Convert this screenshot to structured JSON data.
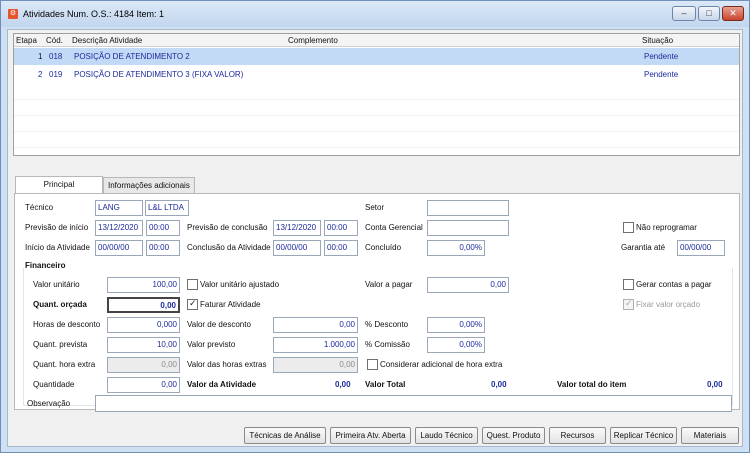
{
  "window": {
    "title": "Atividades Num. O.S.: 4184  Item: 1",
    "minimize": "–",
    "maximize": "□",
    "close": "✕"
  },
  "grid": {
    "columns": [
      "Etapa",
      "Cód.",
      "Descrição Atividade",
      "Complemento",
      "Situação"
    ],
    "rows": [
      {
        "etapa": "1",
        "cod": "018",
        "descricao": "POSIÇÃO DE ATENDIMENTO 2",
        "complemento": "",
        "situacao": "Pendente",
        "selected": true
      },
      {
        "etapa": "2",
        "cod": "019",
        "descricao": "POSIÇÃO DE ATENDIMENTO 3 (FIXA VALOR)",
        "complemento": "",
        "situacao": "Pendente",
        "selected": false
      }
    ]
  },
  "tabs": [
    {
      "label": "Principal",
      "active": true
    },
    {
      "label": "Informações adicionais",
      "active": false
    }
  ],
  "form": {
    "tecnico_label": "Técnico",
    "tecnico_code": "LANG",
    "tecnico_name": "L&L LTDA",
    "setor_label": "Setor",
    "setor_value": "",
    "prev_inicio_label": "Previsão de início",
    "prev_inicio_date": "13/12/2020",
    "prev_inicio_time": "00:00",
    "prev_conclusao_label": "Previsão de conclusão",
    "prev_conclusao_date": "13/12/2020",
    "prev_conclusao_time": "00:00",
    "conta_gerencial_label": "Conta Gerencial",
    "conta_gerencial_value": "",
    "nao_reprogramar_label": "Não reprogramar",
    "inicio_atividade_label": "Início da Atividade",
    "inicio_atividade_date": "00/00/00",
    "inicio_atividade_time": "00:00",
    "conclusao_atividade_label": "Conclusão da Atividade",
    "conclusao_atividade_date": "00/00/00",
    "conclusao_atividade_time": "00:00",
    "concluido_label": "Concluído",
    "concluido_value": "0,00%",
    "garantia_label": "Garantia até",
    "garantia_value": "00/00/00"
  },
  "financeiro": {
    "title": "Financeiro",
    "valor_unitario_label": "Valor unitário",
    "valor_unitario": "100,00",
    "valor_unitario_ajustado_label": "Valor unitário ajustado",
    "valor_a_pagar_label": "Valor a pagar",
    "valor_a_pagar": "0,00",
    "gerar_contas_label": "Gerar contas a pagar",
    "quant_orcada_label": "Quant. orçada",
    "quant_orcada": "0,00",
    "faturar_label": "Faturar Atividade",
    "fixar_valor_label": "Fixar valor orçado",
    "horas_desconto_label": "Horas de desconto",
    "horas_desconto": "0,000",
    "valor_desconto_label": "Valor de desconto",
    "valor_desconto": "0,00",
    "pct_desconto_label": "% Desconto",
    "pct_desconto": "0,00%",
    "quant_prevista_label": "Quant. prevista",
    "quant_prevista": "10,00",
    "valor_previsto_label": "Valor previsto",
    "valor_previsto": "1.000,00",
    "pct_comissao_label": "% Comissão",
    "pct_comissao": "0,00%",
    "quant_hora_extra_label": "Quant. hora extra",
    "quant_hora_extra": "0,00",
    "valor_horas_extras_label": "Valor das horas extras",
    "valor_horas_extras": "0,00",
    "considerar_adicional_label": "Considerar adicional de hora extra",
    "quantidade_label": "Quantidade",
    "quantidade": "0,00",
    "valor_atividade_label": "Valor da Atividade",
    "valor_atividade": "0,00",
    "valor_total_label": "Valor Total",
    "valor_total": "0,00",
    "valor_total_item_label": "Valor total do item",
    "valor_total_item": "0,00"
  },
  "observacao": {
    "label": "Observação",
    "value": ""
  },
  "buttons": {
    "tecnicas": "Técnicas de Análise",
    "primeira": "Primeira Atv. Aberta",
    "laudo": "Laudo Técnico",
    "quest": "Quest. Produto",
    "recursos": "Recursos",
    "replicar": "Replicar Técnico",
    "materiais": "Materiais"
  },
  "colors": {
    "selected_row": "#c3daf7",
    "value_text": "#1c2a9a",
    "window_frame": "#cfe0f3"
  }
}
